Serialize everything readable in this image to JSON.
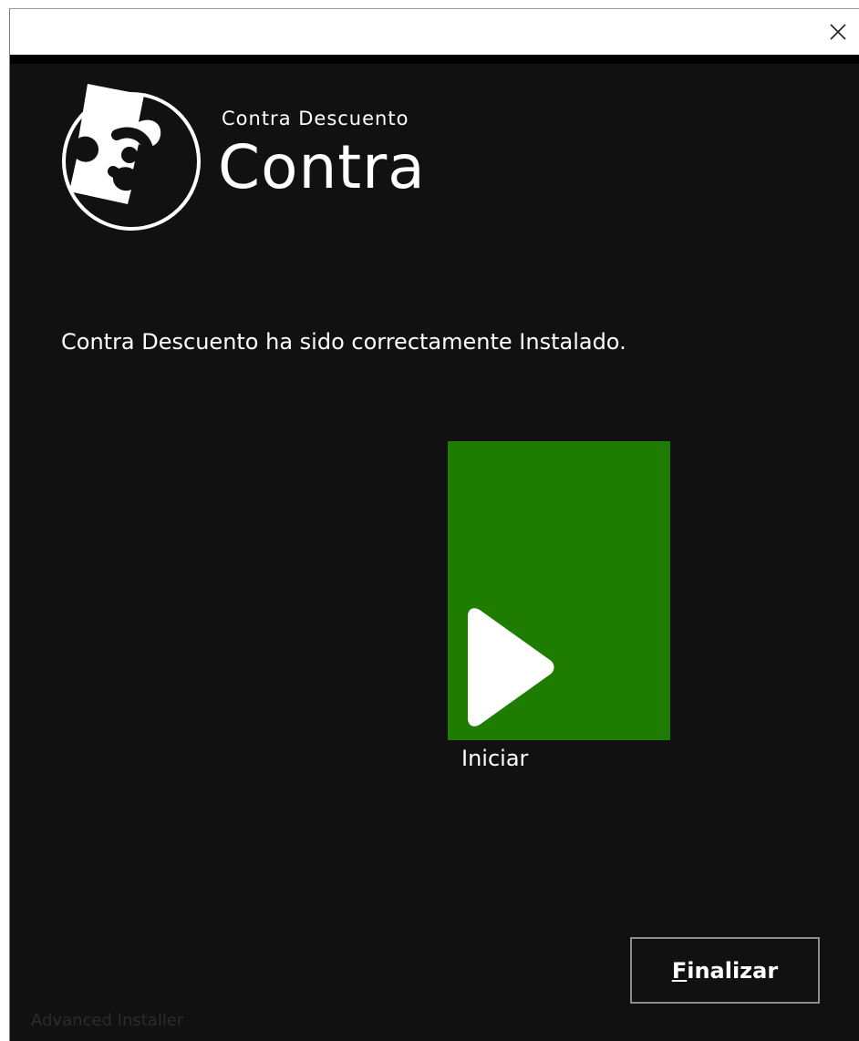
{
  "window": {
    "close_icon": "close-icon",
    "title": ""
  },
  "header": {
    "logo_icon": "puzzle-disc-logo-icon",
    "subtitle": "Contra Descuento",
    "title": "Contra"
  },
  "main": {
    "message": "Contra Descuento ha sido correctamente Instalado.",
    "launch": {
      "icon": "play-icon",
      "label": "Iniciar",
      "tile_color": "#1e7d00"
    }
  },
  "footer": {
    "finish_button": {
      "mnemonic": "F",
      "rest": "inalizar"
    },
    "brand": "Advanced Installer"
  },
  "colors": {
    "background": "#111111",
    "accent": "#1e7d00",
    "text": "#ffffff"
  }
}
